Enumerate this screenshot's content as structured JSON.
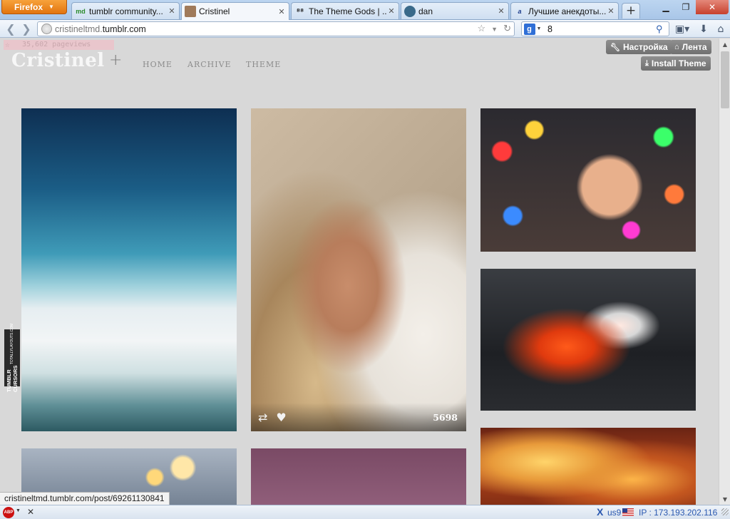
{
  "browser": {
    "menu_button": "Firefox",
    "tabs": [
      {
        "label": "tumblr community...",
        "favicon": "md",
        "active": false
      },
      {
        "label": "Cristinel",
        "favicon": "photo",
        "active": true
      },
      {
        "label": "The Theme Gods | ...",
        "favicon": "glasses",
        "active": false
      },
      {
        "label": "dan",
        "favicon": "avatar",
        "active": false
      },
      {
        "label": "Лучшие анекдоты...",
        "favicon": "a-net",
        "active": false
      }
    ],
    "new_tab": "+",
    "url": {
      "prefix": "cristineltmd.",
      "host": "tumblr.com"
    },
    "search": {
      "engine": "g",
      "query": "8"
    }
  },
  "blog": {
    "pageviews": "35,602 pageviews",
    "title": "Cristinel",
    "plus": "+",
    "nav": [
      "HOME",
      "ARCHIVE",
      "THEME"
    ],
    "controls": {
      "settings": "Настройка",
      "dashboard": "Лента",
      "install": "Install Theme"
    },
    "posts": [
      {
        "image": "clouds-above-sky"
      },
      {
        "image": "girl-on-beach",
        "notes": "5698"
      },
      {
        "image": "hand-holding-fairy-lights"
      },
      {
        "image": "glowing-embers"
      },
      {
        "image": "branches-with-bulbs"
      },
      {
        "image": "mauve-photo"
      },
      {
        "image": "tree-with-lights"
      }
    ],
    "cursors_tab": {
      "title": "TUMBLR CURSORS",
      "subtitle": "TOTALLYLAYOUTS.COM"
    }
  },
  "status": {
    "link": "cristineltmd.tumblr.com/post/69261130841"
  },
  "addon_bar": {
    "abp": "ABP",
    "close": "✕",
    "x_icon": "X",
    "locale": "us9",
    "ip": "IP : 173.193.202.116"
  }
}
